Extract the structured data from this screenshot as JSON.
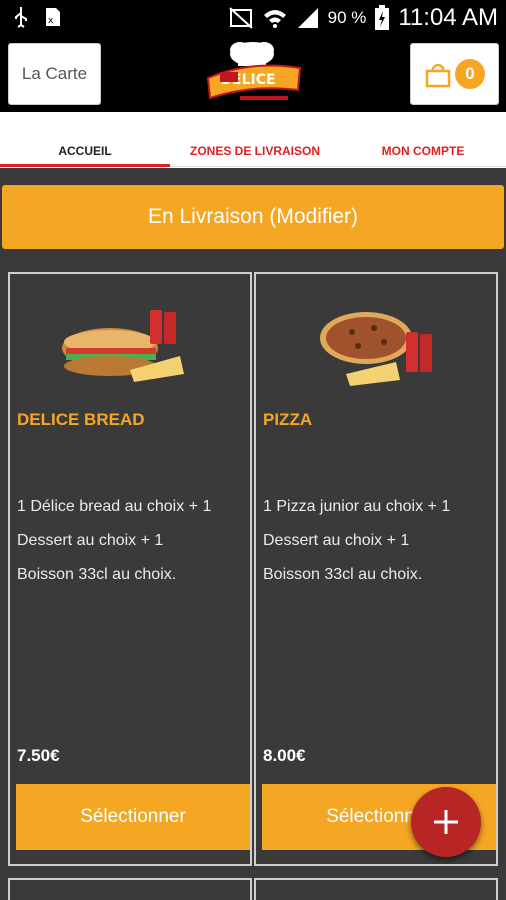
{
  "status_bar": {
    "battery_percent": "90 %",
    "time": "11:04 AM",
    "icons": [
      "usb-icon",
      "sim-icon",
      "mute-icon",
      "wifi-icon",
      "signal-icon",
      "battery-icon"
    ]
  },
  "header": {
    "menu_button_label": "La Carte",
    "cart_count": "0",
    "logo_text": "DELICE",
    "logo_name": "delice-logo"
  },
  "tabs": [
    {
      "label": "ACCUEIL",
      "active": true
    },
    {
      "label": "ZONES DE LIVRAISON",
      "active": false
    },
    {
      "label": "MON COMPTE",
      "active": false
    }
  ],
  "livraison_button": "En Livraison (Modifier)",
  "products": [
    {
      "title": "DELICE BREAD",
      "desc_line1": "1 Délice bread au choix  + 1",
      "desc_line2": "Dessert au choix  + 1",
      "desc_line3": "Boisson 33cl au choix.",
      "price": "7.50€",
      "button": "Sélectionner",
      "image": "sandwich-menu-image"
    },
    {
      "title": "PIZZA",
      "desc_line1": "1 Pizza junior au choix  + 1",
      "desc_line2": "Dessert au choix  + 1",
      "desc_line3": "Boisson 33cl au choix.",
      "price": "8.00€",
      "button": "Sélectionner",
      "image": "pizza-menu-image"
    }
  ],
  "colors": {
    "accent": "#f5a623",
    "tab_active": "#e02020",
    "background_dark": "#3a3a3a",
    "fab": "#b82525"
  }
}
